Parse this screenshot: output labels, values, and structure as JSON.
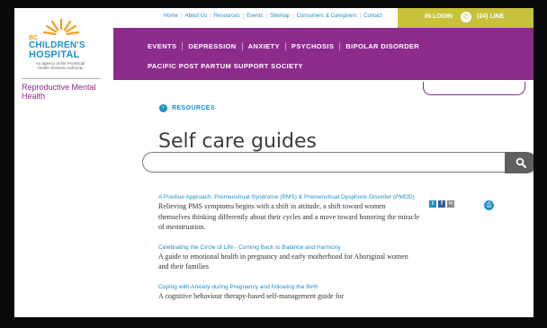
{
  "logo": {
    "bc": "BC",
    "line1": "CHILDREN'S",
    "line2": "HOSPITAL",
    "sub": "An agency of the Provincial Health Services Authority"
  },
  "sidebar": {
    "link": "Reproductive Mental Health"
  },
  "topnav": {
    "links": [
      "Home",
      "About Us",
      "Resources",
      "Events",
      "Sitemap",
      "Consumers & Caregivers",
      "Contact"
    ],
    "login": "IN LOGIN",
    "phone": "(24) LINE"
  },
  "menu": {
    "items": [
      "EVENTS",
      "DEPRESSION",
      "ANXIETY",
      "PSYCHOSIS",
      "BIPOLAR DISORDER"
    ],
    "second": "PACIFIC POST PARTUM SUPPORT SOCIETY"
  },
  "breadcrumb": {
    "label": "RESOURCES"
  },
  "page": {
    "title": "Self care guides"
  },
  "search": {
    "value": "",
    "placeholder": ""
  },
  "results": [
    {
      "title": "A Positive Approach: Premenstrual Syndrome (PMS) & Premenstrual Dysphoric Disorder (PMDD)",
      "desc": "Relieving PMS symptoms begins with a shift in attitude, a shift toward women themselves thinking differently about their cycles and a move toward honoring the miracle of menstruation."
    },
    {
      "title": "Celebrating the Circle of Life - Coming Back to Balance and Harmony",
      "desc": "A guide to emotional health in pregnancy and early motherhood for Aboriginal women and their families"
    },
    {
      "title": "Coping with Anxiety during Pregnancy and following the Birth",
      "desc": "A cognitive behaviour therapy-based self-management guide for"
    }
  ],
  "share": {
    "twitter": "t",
    "facebook": "f",
    "email": "✉"
  },
  "colors": {
    "purple": "#8d2b8b",
    "blue": "#1f8fc8",
    "olive": "#c7c13b",
    "orange": "#f39c1f"
  }
}
